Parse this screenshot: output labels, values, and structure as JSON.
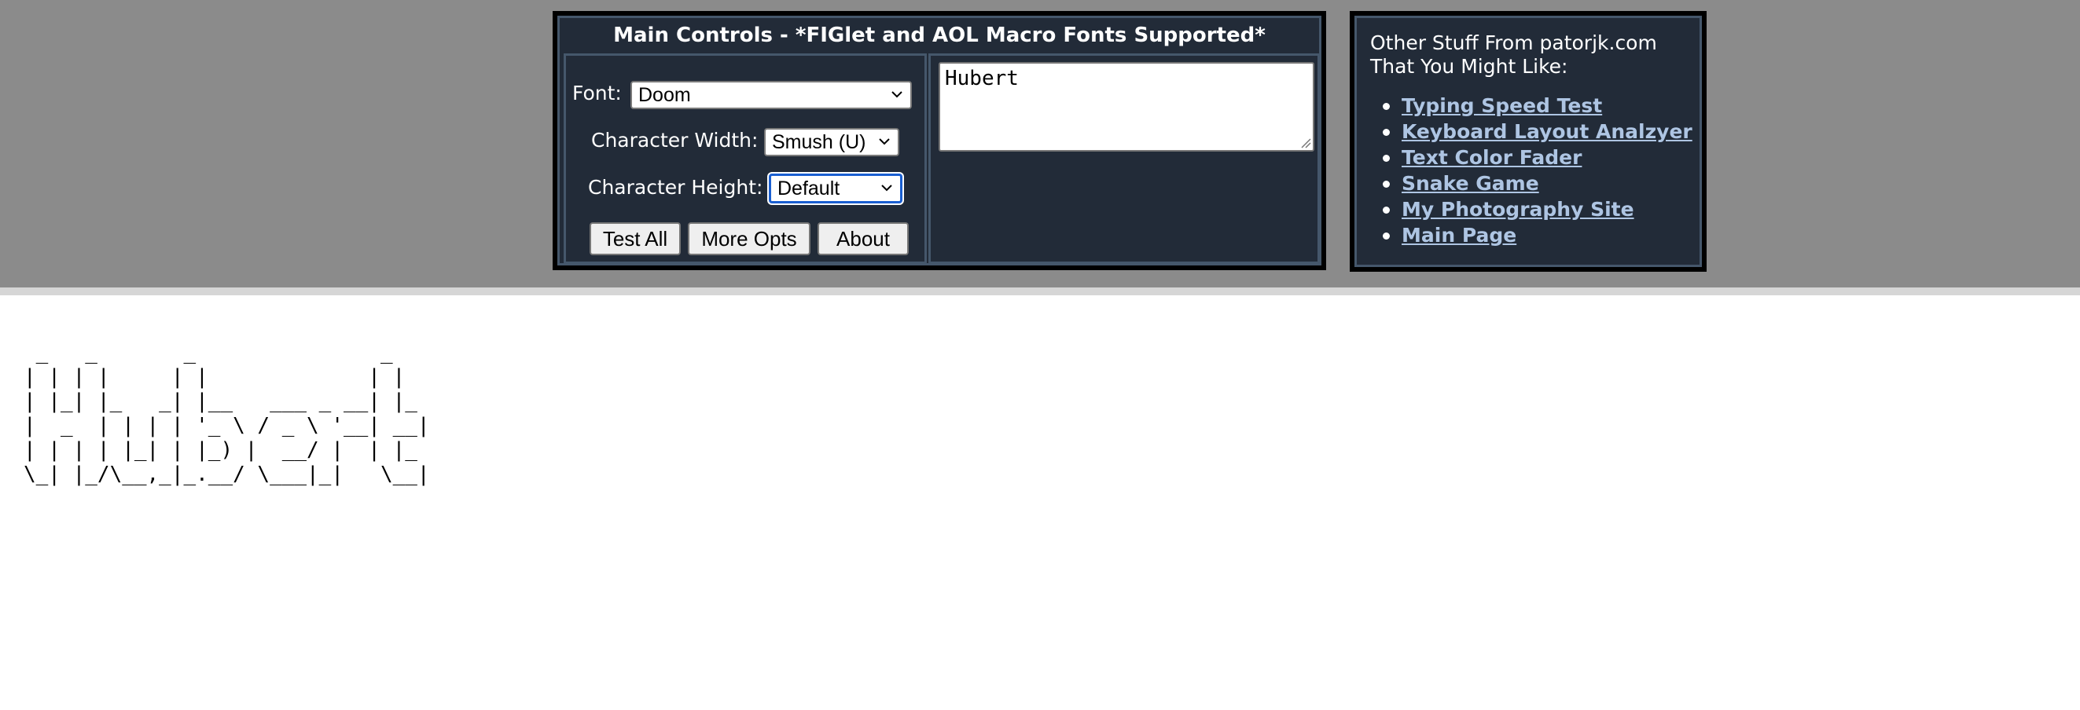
{
  "main_controls": {
    "title": "Main Controls - *FIGlet and AOL Macro Fonts Supported*",
    "font_label": "Font:",
    "font_value": "Doom",
    "char_width_label": "Character Width:",
    "char_width_value": "Smush (U)",
    "char_height_label": "Character Height:",
    "char_height_value": "Default",
    "buttons": {
      "test_all": "Test All",
      "more_opts": "More Opts",
      "about": "About"
    },
    "input_text": "Hubert"
  },
  "other_stuff": {
    "heading_line1": "Other Stuff From patorjk.com",
    "heading_line2": "That You Might Like:",
    "links": [
      "Typing Speed Test",
      "Keyboard Layout Analzyer",
      "Text Color Fader",
      "Snake Game",
      "My Photography Site",
      "Main Page"
    ]
  },
  "output": {
    "ascii_art": " _   _       _               _   \n| | | |     | |             | |  \n| |_| |_   _| |__   ___ _ __| |_ \n|  _  | | | | '_ \\ / _ \\ '__| __|\n| | | | |_| | |_) |  __/ |  | |_ \n\\_| |_/\\__,_|_.__/ \\___|_|   \\__|"
  },
  "colors": {
    "band": "#8b8b8b",
    "panel": "#222b38",
    "panel_inner_border": "#45576b",
    "link": "#aec5e3",
    "focus": "#1a5fd1"
  }
}
